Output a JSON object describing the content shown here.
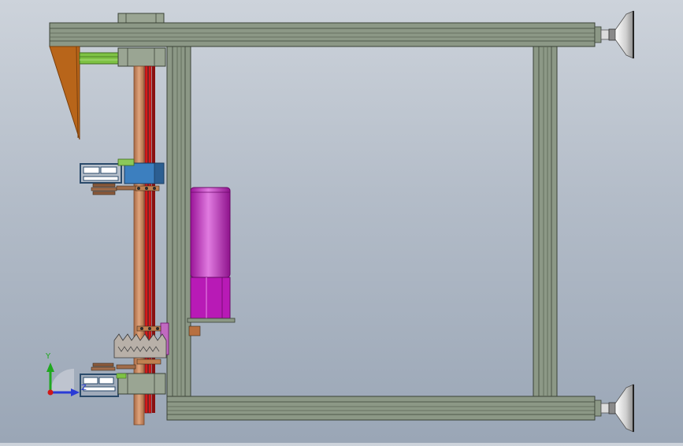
{
  "viewport": {
    "background_top": "#cdd3db",
    "background_bottom": "#9aa6b6"
  },
  "colors": {
    "frame_fill": "#8c9886",
    "frame_stroke": "#3a4236",
    "frame_groove": "#6e7a68",
    "bracket_orange": "#b8651a",
    "bracket_orange_dark": "#7a3f0c",
    "green_rod": "#7ec244",
    "copper_shaft": "#c98a62",
    "red_chain": "#d21a1a",
    "motor_magenta": "#c21fbf",
    "motor_highlight": "#e07be0",
    "blue_block": "#3c7fbf",
    "foot_silver": "#c9c9c9",
    "axis_y": "#1fa81f",
    "axis_x": "#2a3bd6",
    "axis_origin": "#d01818"
  },
  "triad": {
    "x_label": "Z",
    "y_label": "Y"
  }
}
